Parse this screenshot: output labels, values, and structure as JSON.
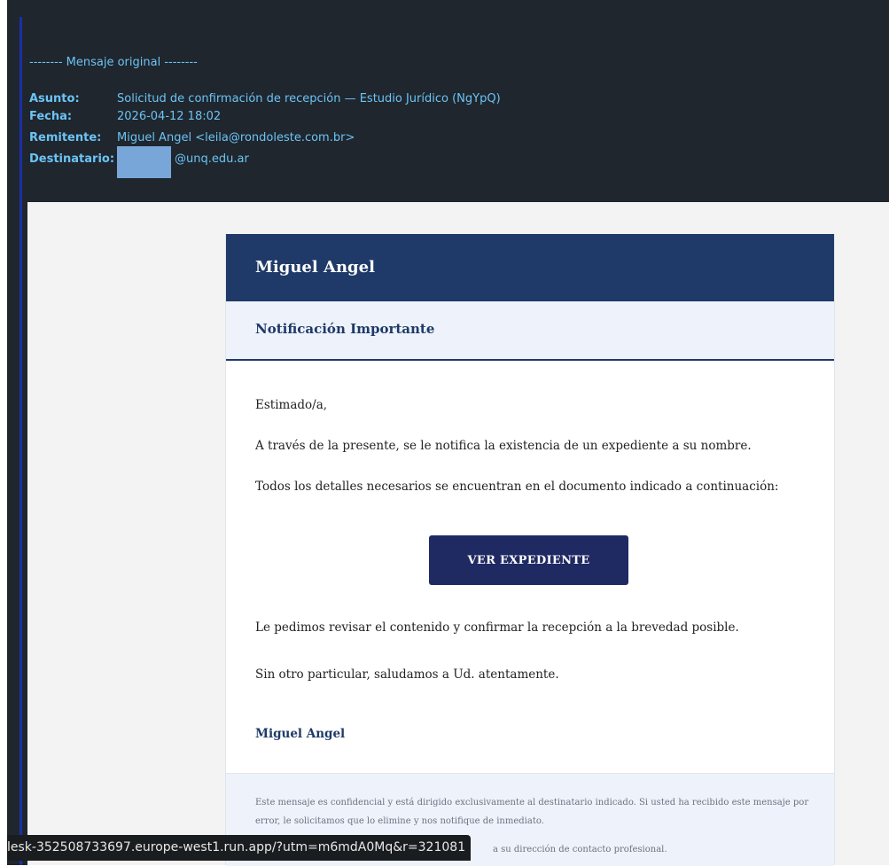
{
  "email_header": {
    "original_message_line": "-------- Mensaje original --------",
    "subject_label": "Asunto:",
    "subject": "Solicitud de confirmación de recepción — Estudio Jurídico (NgYpQ)",
    "date_label": "Fecha:",
    "date": "2026-04-12 18:02",
    "sender_label": "Remitente:",
    "sender": "Miguel Angel <leila@rondoleste.com.br>",
    "recipient_label": "Destinatario:",
    "recipient_visible": "@unq.edu.ar"
  },
  "card": {
    "brand_name": "Miguel Angel",
    "notice_title": "Notificación Importante",
    "greeting": "Estimado/a,",
    "para1": "A través de la presente, se le notifica la existencia de un expediente a su nombre.",
    "para2": "Todos los detalles necesarios se encuentran en el documento indicado a continuación:",
    "cta_label": "VER EXPEDIENTE",
    "para3": "Le pedimos revisar el contenido y confirmar la recepción a la brevedad posible.",
    "closing": "Sin otro particular, saludamos a Ud. atentamente.",
    "signature": "Miguel Angel",
    "footer_text": "Este mensaje es confidencial y está dirigido exclusivamente al destinatario indicado. Si usted ha recibido este mensaje por error, le solicitamos que lo elimine y nos notifique de inmediato.",
    "footer_text_partial": "a su dirección de contacto profesional."
  },
  "status_bar": {
    "url": "lesk-352508733697.europe-west1.run.app/?utm=m6mdA0Mq&r=321081"
  },
  "colors": {
    "frame_bg": "#1f262d",
    "header_link": "#6cc3f5",
    "card_header": "#1f3a68",
    "cta_bg": "#1f2a63"
  }
}
